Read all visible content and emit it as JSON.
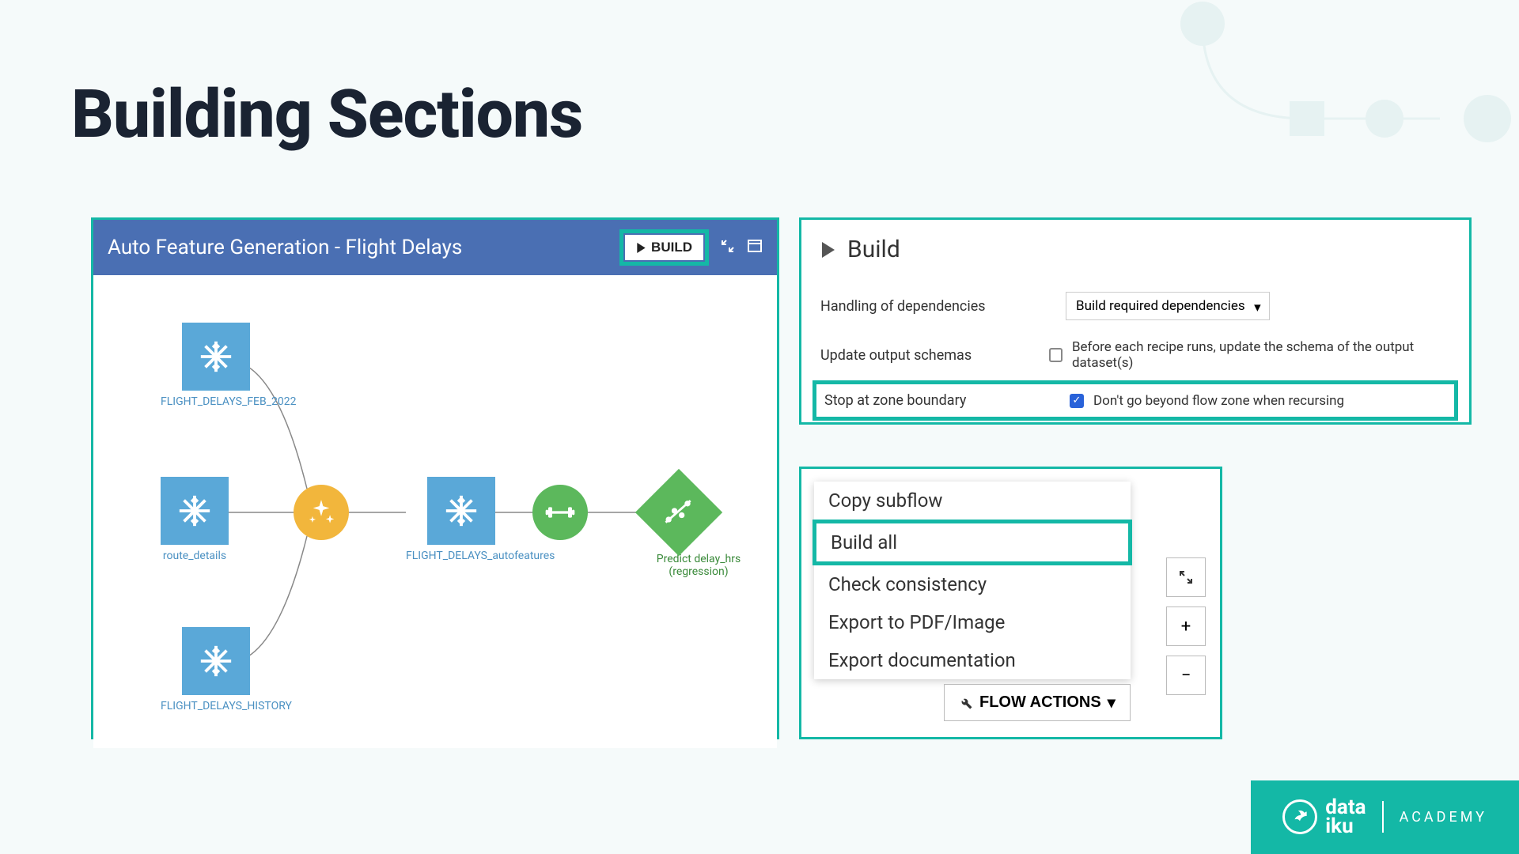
{
  "title": "Building Sections",
  "flow": {
    "header_title": "Auto Feature Generation - Flight Delays",
    "build_button": "BUILD",
    "nodes": {
      "n1": "FLIGHT_DELAYS_FEB_2022",
      "n2": "route_details",
      "n3": "FLIGHT_DELAYS_HISTORY",
      "n4": "FLIGHT_DELAYS_autofeatures",
      "n5": "Predict delay_hrs (regression)"
    }
  },
  "build_panel": {
    "heading": "Build",
    "opt1_label": "Handling of dependencies",
    "opt1_value": "Build required dependencies",
    "opt2_label": "Update output schemas",
    "opt2_desc": "Before each recipe runs, update the schema of the output dataset(s)",
    "opt3_label": "Stop at zone boundary",
    "opt3_desc": "Don't go beyond flow zone when recursing"
  },
  "menu": {
    "items": [
      "Copy subflow",
      "Build all",
      "Check consistency",
      "Export to PDF/Image",
      "Export documentation"
    ],
    "flow_actions": "FLOW ACTIONS"
  },
  "brand": {
    "name1": "data",
    "name2": "iku",
    "academy": "ACADEMY"
  }
}
